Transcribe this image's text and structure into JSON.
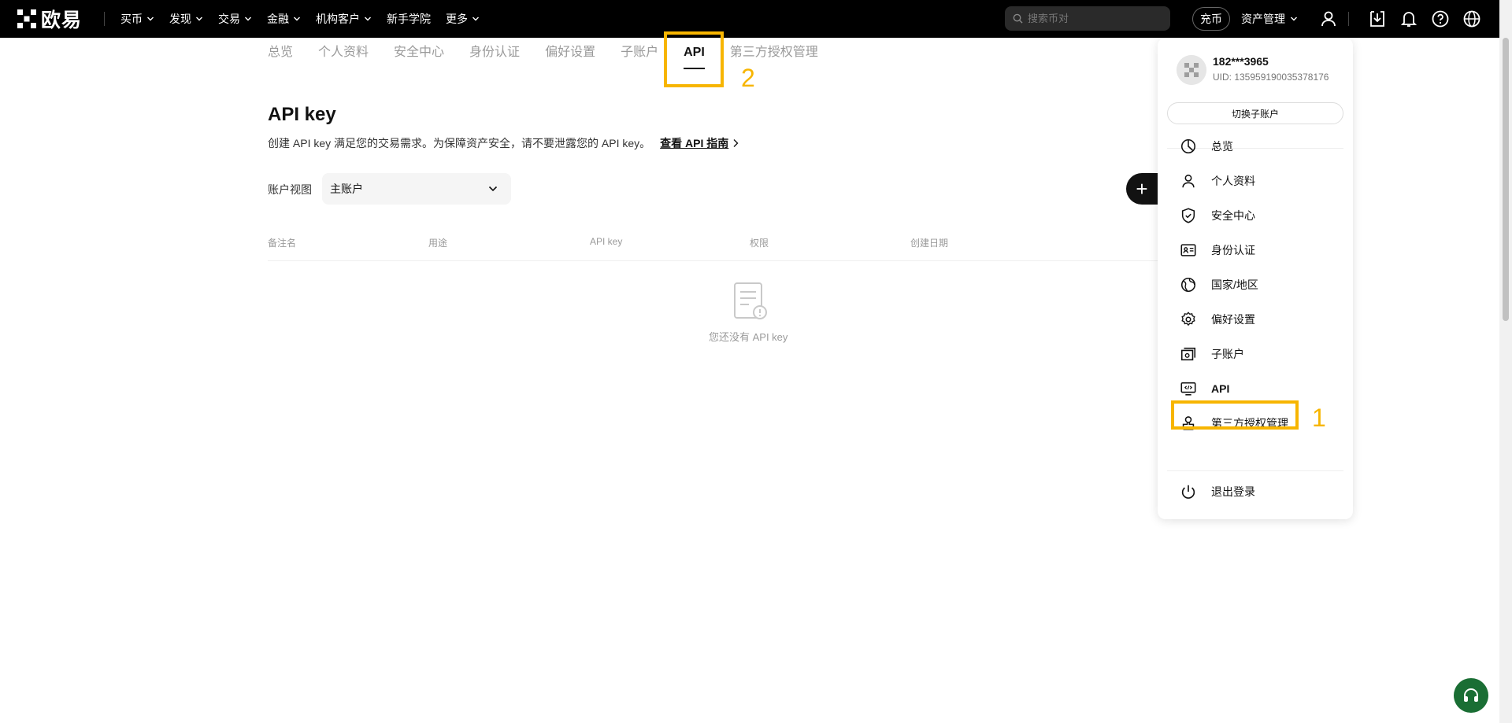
{
  "brand": {
    "name": "欧易"
  },
  "nav": [
    "买币",
    "发现",
    "交易",
    "金融",
    "机构客户",
    "新手学院",
    "更多"
  ],
  "nav_has_chevron": [
    true,
    true,
    true,
    true,
    true,
    false,
    true
  ],
  "search": {
    "placeholder": "搜索币对"
  },
  "header": {
    "deposit": "充币",
    "assets": "资产管理"
  },
  "tabs": [
    "总览",
    "个人资料",
    "安全中心",
    "身份认证",
    "偏好设置",
    "子账户",
    "API",
    "第三方授权管理"
  ],
  "active_tab": "API",
  "annotations": {
    "tab_marker": "2",
    "menu_marker": "1"
  },
  "page": {
    "title": "API key",
    "description": "创建 API key 满足您的交易需求。为保障资产安全，请不要泄露您的 API key。",
    "guide_link": "查看 API 指南",
    "account_view_label": "账户视图",
    "account_selected": "主账户",
    "create_symbol": "+"
  },
  "table": {
    "headers": [
      "备注名",
      "用途",
      "API key",
      "权限",
      "创建日期"
    ],
    "empty_text": "您还没有 API key"
  },
  "dropdown": {
    "user": "182***3965",
    "uid": "UID: 135959190035378176",
    "switch_label": "切换子账户",
    "items": [
      "总览",
      "个人资料",
      "安全中心",
      "身份认证",
      "国家/地区",
      "偏好设置",
      "子账户",
      "API",
      "第三方授权管理"
    ],
    "logout": "退出登录"
  },
  "colors": {
    "highlight": "#f7b500",
    "topbar": "#000000",
    "support": "#1a6e34"
  }
}
